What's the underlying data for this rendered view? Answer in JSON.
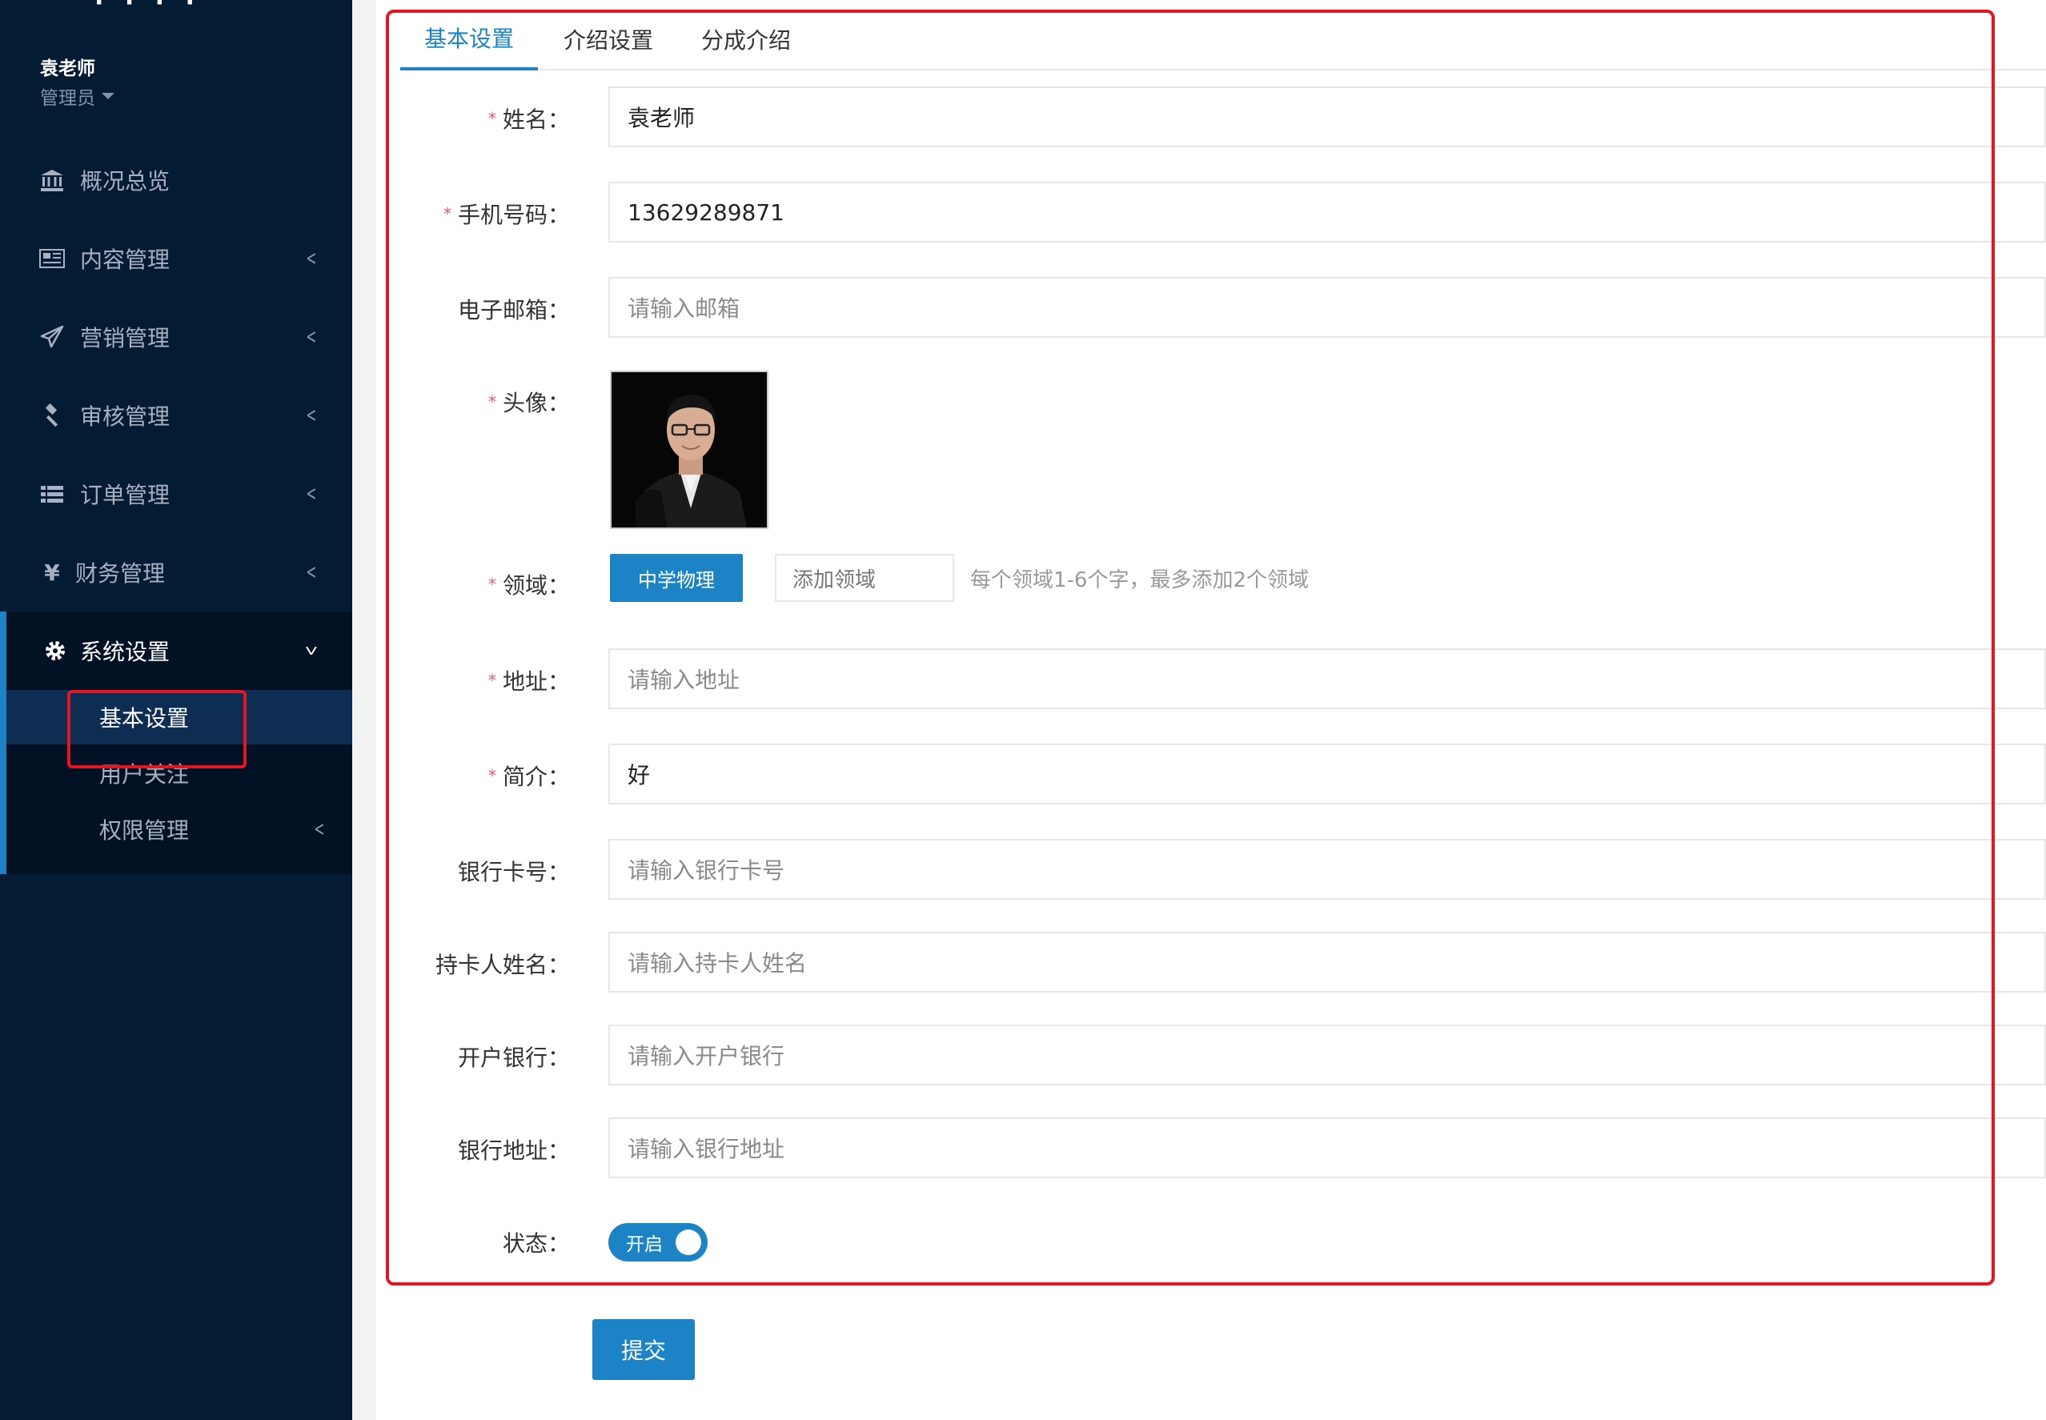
{
  "sidebar": {
    "user_name": "袁老师",
    "user_role": "管理员",
    "items": [
      {
        "icon": "bank-icon",
        "label": "概况总览"
      },
      {
        "icon": "newspaper-icon",
        "label": "内容管理"
      },
      {
        "icon": "paper-plane-icon",
        "label": "营销管理"
      },
      {
        "icon": "gavel-icon",
        "label": "审核管理"
      },
      {
        "icon": "list-icon",
        "label": "订单管理"
      },
      {
        "icon": "yen-icon",
        "label": "财务管理"
      },
      {
        "icon": "gear-icon",
        "label": "系统设置"
      }
    ],
    "sub_items": [
      {
        "label": "基本设置"
      },
      {
        "label": "用户关注"
      },
      {
        "label": "权限管理"
      }
    ]
  },
  "tabs": [
    {
      "label": "基本设置"
    },
    {
      "label": "介绍设置"
    },
    {
      "label": "分成介绍"
    }
  ],
  "form": {
    "name": {
      "label": "姓名：",
      "value": "袁老师"
    },
    "phone": {
      "label": "手机号码：",
      "value": "13629289871"
    },
    "email": {
      "label": "电子邮箱：",
      "placeholder": "请输入邮箱"
    },
    "avatar": {
      "label": "头像："
    },
    "field": {
      "label": "领域：",
      "tag": "中学物理",
      "add_placeholder": "添加领域",
      "hint": "每个领域1-6个字，最多添加2个领域"
    },
    "address": {
      "label": "地址：",
      "placeholder": "请输入地址"
    },
    "intro": {
      "label": "简介：",
      "value": "好"
    },
    "bank_card": {
      "label": "银行卡号：",
      "placeholder": "请输入银行卡号"
    },
    "holder": {
      "label": "持卡人姓名：",
      "placeholder": "请输入持卡人姓名"
    },
    "bank": {
      "label": "开户银行：",
      "placeholder": "请输入开户银行"
    },
    "bank_address": {
      "label": "银行地址：",
      "placeholder": "请输入银行地址"
    },
    "status": {
      "label": "状态：",
      "toggle_text": "开启"
    }
  },
  "submit_label": "提交",
  "colors": {
    "accent": "#1c84c6",
    "sidebar_bg": "#041b34",
    "highlight": "#e5141f",
    "required": "#ed5565"
  }
}
